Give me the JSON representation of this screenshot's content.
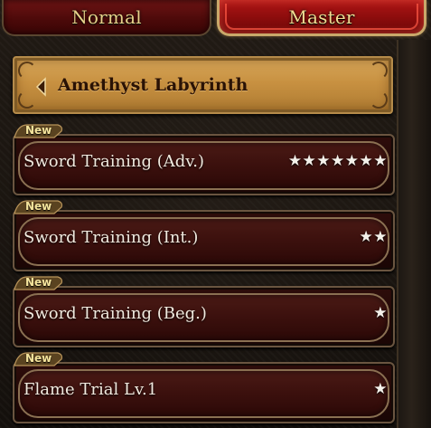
{
  "tabs": [
    {
      "label": "Normal",
      "active": false
    },
    {
      "label": "Master",
      "active": true
    }
  ],
  "header": {
    "title": "Amethyst Labyrinth",
    "back_icon": "chevron-left-icon"
  },
  "quests": [
    {
      "badge": "New",
      "name": "Sword Training (Adv.)",
      "stars": "★★★★★★★",
      "difficulty_stars": 7
    },
    {
      "badge": "New",
      "name": "Sword Training (Int.)",
      "stars": "★★",
      "difficulty_stars": 2
    },
    {
      "badge": "New",
      "name": "Sword Training (Beg.)",
      "stars": "★",
      "difficulty_stars": 1
    },
    {
      "badge": "New",
      "name": "Flame Trial Lv.1",
      "stars": "★",
      "difficulty_stars": 1
    }
  ],
  "colors": {
    "active_tab": "#9b1010",
    "inactive_tab": "#4a0909",
    "header_gold": "#c89141",
    "row_plate": "#2e0d0b",
    "text_light": "#f1eadf",
    "tab_text": "#e8d28a"
  }
}
